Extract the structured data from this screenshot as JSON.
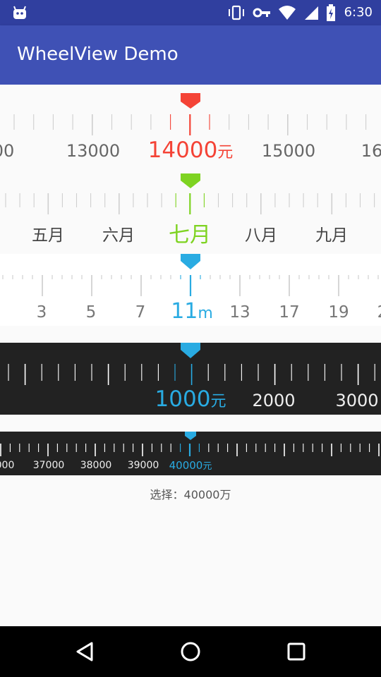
{
  "status_bar": {
    "time": "6:30"
  },
  "app_bar": {
    "title": "WheelView Demo"
  },
  "wheels": [
    {
      "id": "wheel1",
      "accent": "#f44336",
      "labels": [
        {
          "text": "00",
          "selected": false
        },
        {
          "text": "13000",
          "selected": false
        },
        {
          "text": "14000",
          "unit": "元",
          "selected": true
        },
        {
          "text": "15000",
          "selected": false
        },
        {
          "text": "16",
          "selected": false
        }
      ]
    },
    {
      "id": "wheel2",
      "accent": "#7ed321",
      "labels": [
        {
          "text": "五月",
          "selected": false
        },
        {
          "text": "六月",
          "selected": false
        },
        {
          "text": "七月",
          "selected": true
        },
        {
          "text": "八月",
          "selected": false
        },
        {
          "text": "九月",
          "selected": false
        }
      ]
    },
    {
      "id": "wheel3",
      "accent": "#29abe2",
      "labels": [
        {
          "text": "3",
          "selected": false
        },
        {
          "text": "5",
          "selected": false
        },
        {
          "text": "7",
          "selected": false
        },
        {
          "text": "11",
          "unit": "m",
          "selected": true
        },
        {
          "text": "13",
          "selected": false
        },
        {
          "text": "17",
          "selected": false
        },
        {
          "text": "19",
          "selected": false
        },
        {
          "text": "2",
          "selected": false
        }
      ]
    },
    {
      "id": "wheel4",
      "accent": "#29abe2",
      "labels": [
        {
          "text": "1000",
          "unit": "元",
          "selected": true
        },
        {
          "text": "2000",
          "selected": false
        },
        {
          "text": "3000",
          "selected": false
        }
      ]
    },
    {
      "id": "wheel5",
      "accent": "#29abe2",
      "labels": [
        {
          "text": "000",
          "selected": false
        },
        {
          "text": "37000",
          "selected": false
        },
        {
          "text": "38000",
          "selected": false
        },
        {
          "text": "39000",
          "selected": false
        },
        {
          "text": "40000",
          "unit": "元",
          "selected": true
        }
      ]
    }
  ],
  "selection_text": "选择：40000万",
  "icons": {
    "status": [
      "android-icon",
      "vibrate-icon",
      "vpn-key-icon",
      "wifi-icon",
      "signal-icon",
      "battery-charging-icon"
    ],
    "nav": [
      "back-icon",
      "home-icon",
      "recents-icon"
    ]
  }
}
